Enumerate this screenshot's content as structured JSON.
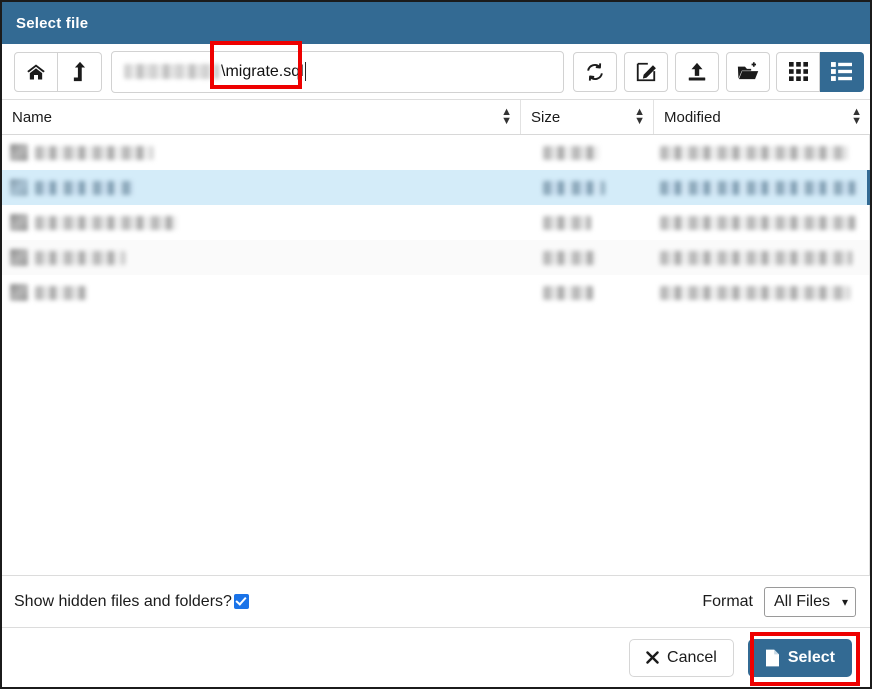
{
  "dialog": {
    "title": "Select file",
    "accent_color": "#336a93",
    "annotation_color": "#ee0000"
  },
  "toolbar": {
    "home_button": "home-icon",
    "up_button": "level-up-icon",
    "refresh_button": "refresh-icon",
    "rename_button": "edit-icon",
    "upload_button": "upload-icon",
    "new_folder_button": "new-folder-icon",
    "grid_view_button": "grid-view-icon",
    "list_view_button": "list-view-icon",
    "active_view": "list"
  },
  "path": {
    "prefix_redacted": true,
    "visible_value": "\\migrate.sql",
    "placeholder": "Path",
    "annotated": true
  },
  "columns": [
    {
      "label": "Name",
      "sort": "sortable"
    },
    {
      "label": "Size",
      "sort": "sortable"
    },
    {
      "label": "Modified",
      "sort": "sortable"
    }
  ],
  "rows": [
    {
      "name_redacted": true,
      "name_w": 118,
      "size_w": 56,
      "mod_w": 188,
      "selected": false,
      "alt": false
    },
    {
      "name_redacted": true,
      "name_w": 98,
      "size_w": 62,
      "mod_w": 200,
      "selected": true,
      "alt": false
    },
    {
      "name_redacted": true,
      "name_w": 142,
      "size_w": 48,
      "mod_w": 196,
      "selected": false,
      "alt": false
    },
    {
      "name_redacted": true,
      "name_w": 90,
      "size_w": 52,
      "mod_w": 192,
      "selected": false,
      "alt": true
    },
    {
      "name_redacted": true,
      "name_w": 52,
      "size_w": 50,
      "mod_w": 190,
      "selected": false,
      "alt": false
    }
  ],
  "footer": {
    "hidden_files_label": "Show hidden files and folders?",
    "hidden_files_checked": true,
    "format_label": "Format",
    "format_value": "All Files",
    "format_options": [
      "All Files"
    ]
  },
  "buttons": {
    "cancel_label": "Cancel",
    "cancel_icon": "close-icon",
    "select_label": "Select",
    "select_icon": "file-icon",
    "select_annotated": true
  }
}
